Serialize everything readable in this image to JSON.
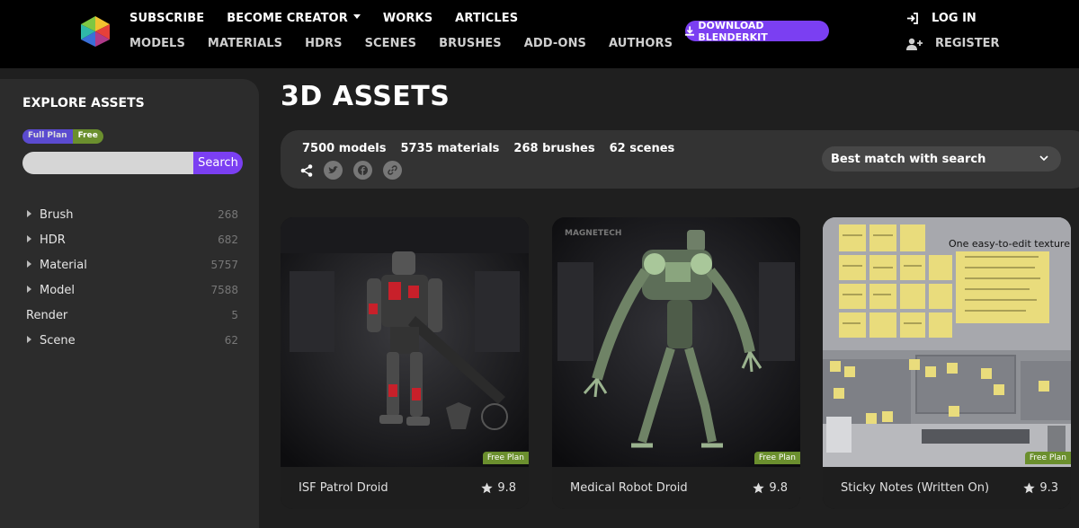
{
  "header": {
    "nav_top": [
      "SUBSCRIBE",
      "BECOME CREATOR",
      "WORKS",
      "ARTICLES"
    ],
    "nav_bottom": [
      "MODELS",
      "MATERIALS",
      "HDRS",
      "SCENES",
      "BRUSHES",
      "ADD-ONS",
      "AUTHORS"
    ],
    "download_label": "DOWNLOAD BLENDERKIT",
    "login_label": "LOG IN",
    "register_label": "REGISTER"
  },
  "sidebar": {
    "title": "EXPLORE ASSETS",
    "plan_full": "Full Plan",
    "plan_free": "Free",
    "search_placeholder": "",
    "search_button": "Search",
    "categories": [
      {
        "label": "Brush",
        "count": "268"
      },
      {
        "label": "HDR",
        "count": "682"
      },
      {
        "label": "Material",
        "count": "5757"
      },
      {
        "label": "Model",
        "count": "7588"
      },
      {
        "label": "Render",
        "count": "5"
      },
      {
        "label": "Scene",
        "count": "62"
      }
    ]
  },
  "main": {
    "title": "3D ASSETS",
    "stats": [
      "7500 models",
      "5735 materials",
      "268 brushes",
      "62 scenes"
    ],
    "sort_label": "Best match with search",
    "cards": [
      {
        "name": "ISF Patrol Droid",
        "rating": "9.8",
        "badge": "Free Plan"
      },
      {
        "name": "Medical Robot Droid",
        "rating": "9.8",
        "badge": "Free Plan",
        "brand": "MAGNETECH"
      },
      {
        "name": "Sticky Notes (Written On)",
        "rating": "9.3",
        "badge": "Free Plan",
        "caption": "One easy-to-edit texture"
      }
    ]
  },
  "colors": {
    "accent": "#7b3ff2",
    "free_badge": "#6b8f2e",
    "header_bg": "#000000"
  }
}
